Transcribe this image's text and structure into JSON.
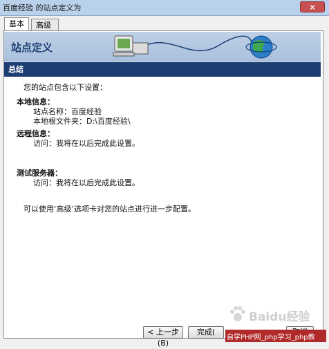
{
  "window": {
    "title": "百度经验 的站点定义为",
    "close_label": "✕"
  },
  "tabs": [
    {
      "label": "基本"
    },
    {
      "label": "高级"
    }
  ],
  "banner": {
    "title": "站点定义"
  },
  "section": {
    "title": "总结"
  },
  "summary": {
    "intro": "您的站点包含以下设置：",
    "local": {
      "heading": "本地信息：",
      "site_name": "站点名称：百度经验",
      "root_folder": "本地根文件夹：D:\\百度经验\\"
    },
    "remote": {
      "heading": "远程信息：",
      "access": "访问：我将在以后完成此设置。"
    },
    "test": {
      "heading": "测试服务器：",
      "access": "访问：我将在以后完成此设置。"
    },
    "footer": "可以使用‘高级’选项卡对您的站点进行进一步配置。"
  },
  "buttons": {
    "back": "< 上一步(B)",
    "finish": "完成(",
    "cancel": "取消"
  },
  "watermark": {
    "logo_text": "Baidu经验",
    "site_text": "自学PHP网_php学习_php教"
  }
}
